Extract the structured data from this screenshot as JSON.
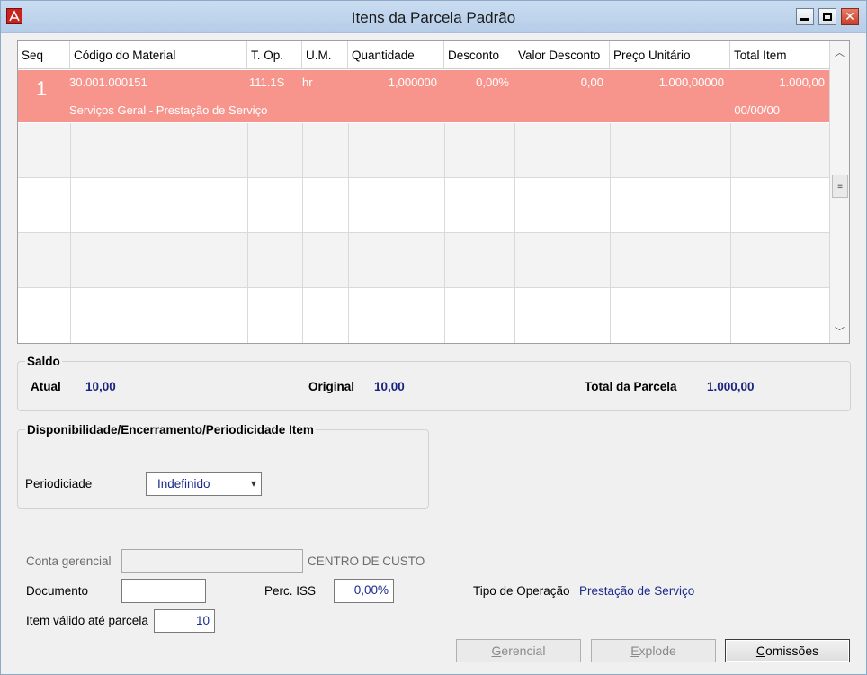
{
  "window": {
    "title": "Itens da Parcela Padrão"
  },
  "grid": {
    "columns": [
      "Seq",
      "Código do Material",
      "T. Op.",
      "U.M.",
      "Quantidade",
      "Desconto",
      "Valor Desconto",
      "Preço Unitário",
      "Total Item"
    ],
    "rows": [
      {
        "seq": "1",
        "codigo": "30.001.000151",
        "top": "111.1S",
        "um": "hr",
        "quantidade": "1,000000",
        "desconto": "0,00%",
        "valor_desconto": "0,00",
        "preco_unitario": "1.000,00000",
        "total_item": "1.000,00",
        "descricao": "Serviços Geral - Prestação de Serviço",
        "data": "00/00/00"
      }
    ]
  },
  "saldo": {
    "title": "Saldo",
    "atual_label": "Atual",
    "atual_value": "10,00",
    "original_label": "Original",
    "original_value": "10,00",
    "total_label": "Total da Parcela",
    "total_value": "1.000,00"
  },
  "disponibilidade": {
    "title": "Disponibilidade/Encerramento/Periodicidade Item",
    "periodicidade_label": "Periodiciade",
    "periodicidade_value": "Indefinido"
  },
  "form": {
    "conta_label": "Conta gerencial",
    "conta_value": "",
    "centro_label": "CENTRO DE CUSTO",
    "documento_label": "Documento",
    "documento_value": "",
    "perc_iss_label": "Perc. ISS",
    "perc_iss_value": "0,00%",
    "tipo_operacao_label": "Tipo de Operação",
    "tipo_operacao_value": "Prestação de Serviço",
    "item_valido_label": "Item válido até parcela",
    "item_valido_value": "10"
  },
  "buttons": {
    "gerencial_first": "G",
    "gerencial_rest": "erencial",
    "explode_first": "E",
    "explode_rest": "xplode",
    "comissoes_first": "C",
    "comissoes_rest": "omissões"
  },
  "colors": {
    "selected_row": "#f7958d",
    "value_text": "#1a237e",
    "title_bar": "#c9dcf1"
  }
}
